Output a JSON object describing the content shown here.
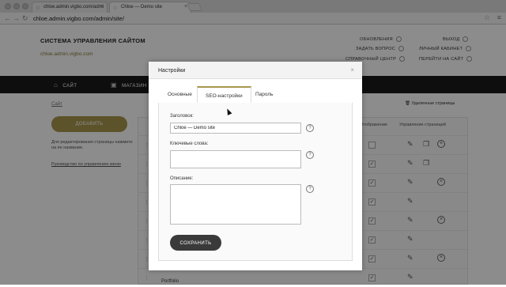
{
  "browser": {
    "tabs": [
      {
        "label": "chloe.admin.vigbo.com/admi",
        "active": false
      },
      {
        "label": "Chloe — Demo site",
        "active": true
      }
    ],
    "url": "chloe.admin.vigbo.com/admin/site/"
  },
  "page": {
    "site_title": "СИСТЕМА УПРАВЛЕНИЯ САЙТОМ",
    "domain": "chloe.admin.vigbo.com",
    "top_links": {
      "update": "ОБНОВЛЕНИЯ",
      "ask": "ЗАДАТЬ ВОПРОС",
      "help": "СПРАВОЧНЫЙ ЦЕНТР",
      "logout": "ВЫХОД",
      "cabinet": "ЛИЧНЫЙ КАБИНЕТ",
      "go_site": "ПЕРЕЙТИ НА САЙТ"
    },
    "nav": {
      "site": "САЙТ",
      "shop": "МАГАЗИН"
    },
    "breadcrumb": "Сайт",
    "add_button": "ДОБАВИТЬ",
    "hint": "Для редактирования страницы нажмите на ее название.",
    "guide_link": "Руководство по управлению меню",
    "deleted_pages": "Удаленные страницы",
    "table": {
      "col_display": "Отображение",
      "col_manage": "Управление страницей",
      "rows": [
        {
          "checked": false
        },
        {
          "checked": true
        },
        {
          "checked": true
        },
        {
          "checked": true
        },
        {
          "checked": true
        },
        {
          "checked": true
        },
        {
          "checked": true
        },
        {
          "checked": true
        }
      ],
      "last_row": "Portfolio"
    }
  },
  "modal": {
    "title": "Настройки",
    "tabs": [
      "Основные",
      "SEO-настройки",
      "Пароль"
    ],
    "active_tab": "SEO-настройки",
    "fields": {
      "title_label": "Заголовок:",
      "title_value": "Chloe — Demo site",
      "keywords_label": "Ключевые слова:",
      "keywords_value": "",
      "description_label": "Описание:",
      "description_value": ""
    },
    "help_glyph": "?",
    "save": "СОХРАНИТЬ"
  },
  "colors": {
    "accent": "#a8974e",
    "nav_bg": "#1b1b1b",
    "save_bg": "#3a3a3a"
  }
}
